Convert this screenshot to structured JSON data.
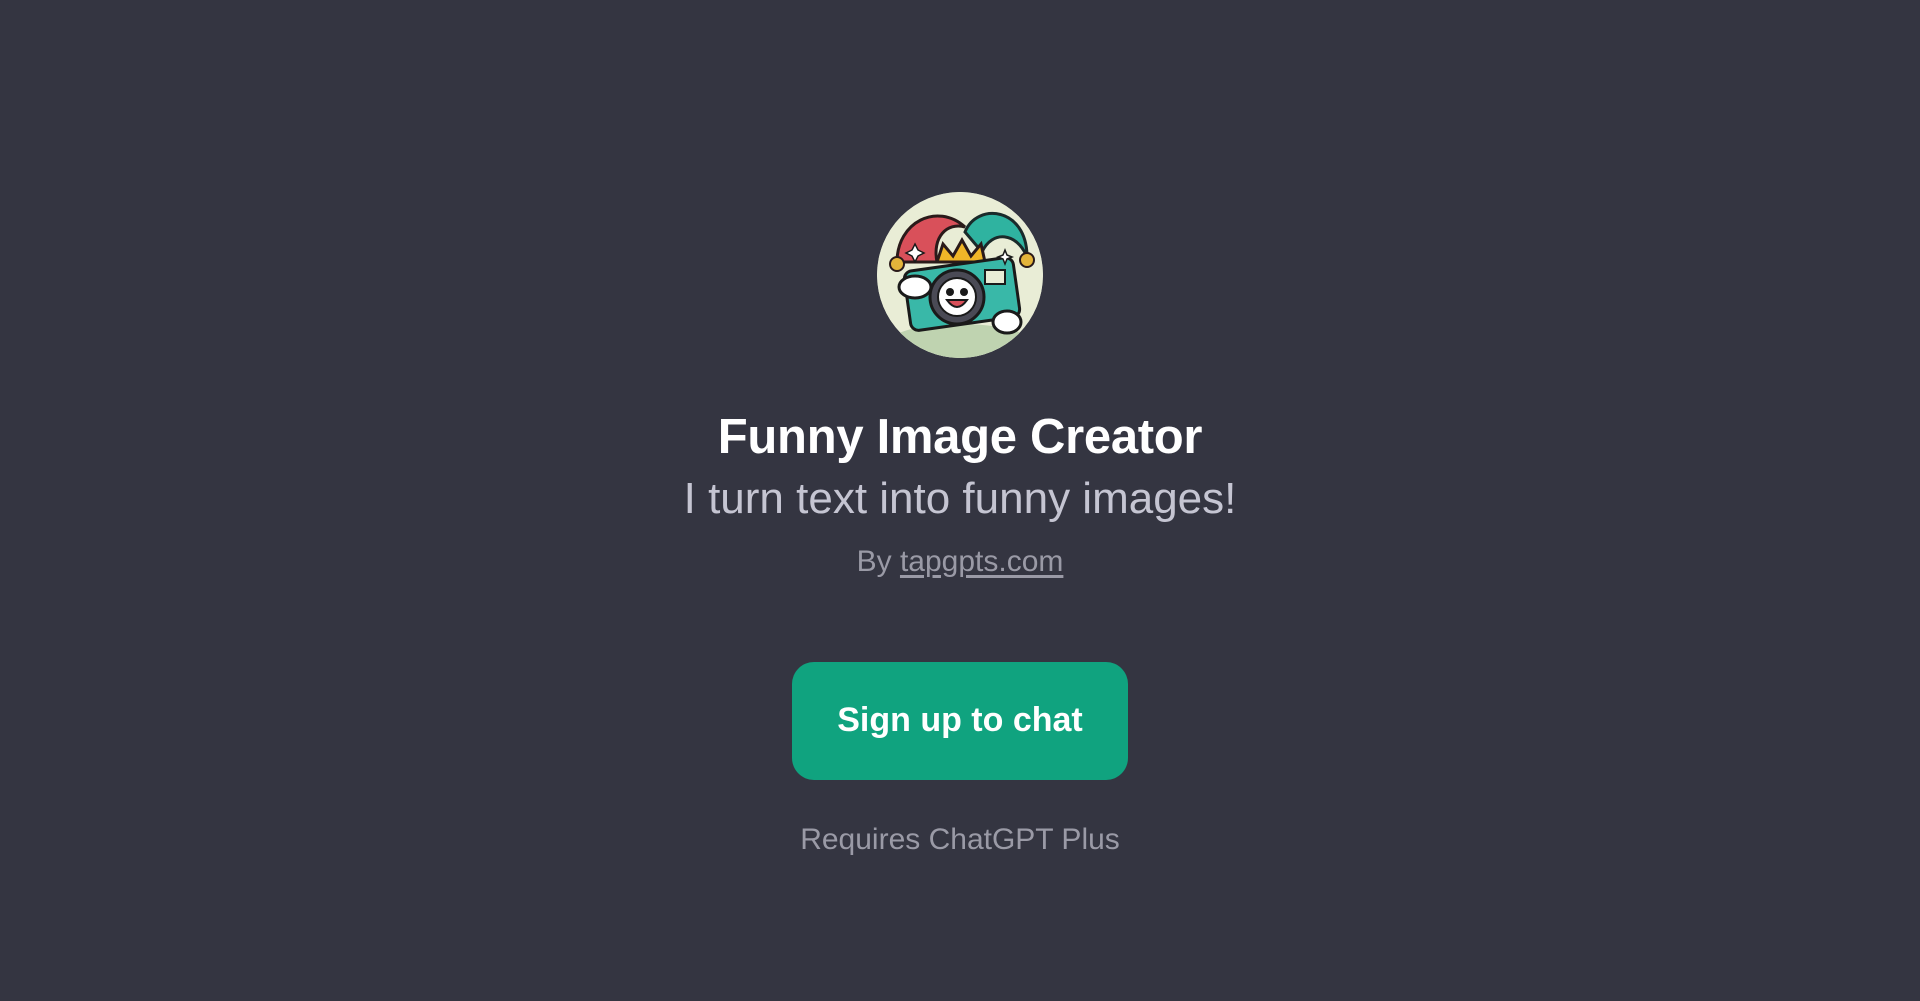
{
  "gpt": {
    "avatar_icon": "jester-camera-logo-icon",
    "name": "Funny Image Creator",
    "description": "I turn text into funny images!",
    "byline_prefix": "By",
    "author": "tapgpts.com"
  },
  "actions": {
    "signup_label": "Sign up to chat"
  },
  "footer": {
    "requirement": "Requires ChatGPT Plus"
  },
  "colors": {
    "background": "#343541",
    "accent": "#10a37f",
    "title": "#ffffff",
    "muted": "#9a9aa6"
  }
}
